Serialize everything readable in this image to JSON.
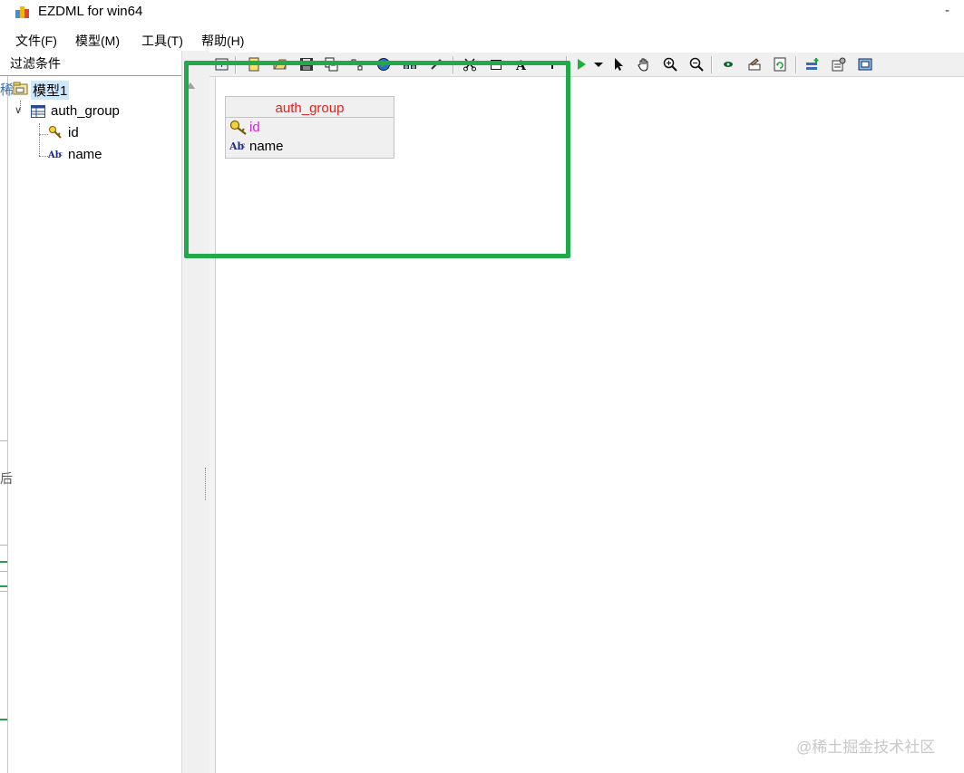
{
  "window": {
    "title": "EZDML for win64",
    "min_glyph": "-"
  },
  "menu": [
    {
      "label": "文件(F)"
    },
    {
      "label": "模型(M)"
    },
    {
      "label": "工具(T)"
    },
    {
      "label": "帮助(H)"
    }
  ],
  "left_panel": {
    "filter_label": "过滤条件",
    "tree": {
      "root": {
        "label": "模型1",
        "icon": "model-icon"
      },
      "table": {
        "label": "auth_group",
        "icon": "table-icon",
        "expander": "∨"
      },
      "fields": [
        {
          "label": "id",
          "icon": "key-icon"
        },
        {
          "label": "name",
          "icon": "text-field-icon"
        }
      ]
    },
    "edge_glyphs": {
      "top": "稀",
      "bottom": "后"
    }
  },
  "toolbar": {
    "icons": [
      "new-model-icon",
      "new-table-icon",
      "open-icon",
      "save-icon",
      "copy-icon",
      "link-icon",
      "globe-icon",
      "binoculars-icon",
      "edit-icon",
      "cut-icon",
      "rectangle-icon",
      "text-icon",
      "dropdown-small-icon",
      "run-icon",
      "dropdown-icon",
      "pointer-icon",
      "hand-icon",
      "zoom-in-icon",
      "zoom-out-icon",
      "view-icon",
      "sign-icon",
      "refresh-icon",
      "add-field-icon",
      "properties-icon",
      "fit-icon"
    ]
  },
  "entity": {
    "title": "auth_group",
    "title_color": "#e8201c",
    "fields": [
      {
        "name": "id",
        "color": "#e020e0",
        "icon": "key-icon"
      },
      {
        "name": "name",
        "color": "#000000",
        "icon": "text-field-icon"
      }
    ]
  },
  "highlight_color": "#22aa4a",
  "watermark": "@稀土掘金技术社区"
}
